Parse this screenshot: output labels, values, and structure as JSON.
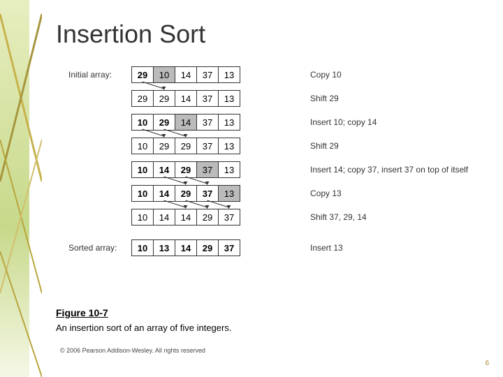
{
  "title": "Insertion Sort",
  "labels": {
    "initial": "Initial array:",
    "sorted": "Sorted array:"
  },
  "rows": [
    {
      "left": "Initial array:",
      "cells": [
        {
          "v": "29",
          "bold": true,
          "shade": false
        },
        {
          "v": "10",
          "bold": false,
          "shade": true
        },
        {
          "v": "14",
          "bold": false,
          "shade": false
        },
        {
          "v": "37",
          "bold": false,
          "shade": false
        },
        {
          "v": "13",
          "bold": false,
          "shade": false
        }
      ],
      "action": "Copy 10",
      "arrows": [
        {
          "from": 0,
          "to": 1
        }
      ]
    },
    {
      "left": "",
      "cells": [
        {
          "v": "29",
          "bold": false,
          "shade": false
        },
        {
          "v": "29",
          "bold": false,
          "shade": false
        },
        {
          "v": "14",
          "bold": false,
          "shade": false
        },
        {
          "v": "37",
          "bold": false,
          "shade": false
        },
        {
          "v": "13",
          "bold": false,
          "shade": false
        }
      ],
      "action": "Shift 29",
      "arrows": []
    },
    {
      "left": "",
      "cells": [
        {
          "v": "10",
          "bold": true,
          "shade": false
        },
        {
          "v": "29",
          "bold": true,
          "shade": false
        },
        {
          "v": "14",
          "bold": false,
          "shade": true
        },
        {
          "v": "37",
          "bold": false,
          "shade": false
        },
        {
          "v": "13",
          "bold": false,
          "shade": false
        }
      ],
      "action": "Insert 10; copy 14",
      "arrows": [
        {
          "from": 0,
          "to": 1
        },
        {
          "from": 1,
          "to": 2
        }
      ]
    },
    {
      "left": "",
      "cells": [
        {
          "v": "10",
          "bold": false,
          "shade": false
        },
        {
          "v": "29",
          "bold": false,
          "shade": false
        },
        {
          "v": "29",
          "bold": false,
          "shade": false
        },
        {
          "v": "37",
          "bold": false,
          "shade": false
        },
        {
          "v": "13",
          "bold": false,
          "shade": false
        }
      ],
      "action": "Shift 29",
      "arrows": []
    },
    {
      "left": "",
      "cells": [
        {
          "v": "10",
          "bold": true,
          "shade": false
        },
        {
          "v": "14",
          "bold": true,
          "shade": false
        },
        {
          "v": "29",
          "bold": true,
          "shade": false
        },
        {
          "v": "37",
          "bold": false,
          "shade": true
        },
        {
          "v": "13",
          "bold": false,
          "shade": false
        }
      ],
      "action": "Insert 14; copy 37, insert 37 on top of itself",
      "arrows": [
        {
          "from": 1,
          "to": 2
        },
        {
          "from": 2,
          "to": 3
        }
      ]
    },
    {
      "left": "",
      "cells": [
        {
          "v": "10",
          "bold": true,
          "shade": false
        },
        {
          "v": "14",
          "bold": true,
          "shade": false
        },
        {
          "v": "29",
          "bold": true,
          "shade": false
        },
        {
          "v": "37",
          "bold": true,
          "shade": false
        },
        {
          "v": "13",
          "bold": false,
          "shade": true
        }
      ],
      "action": "Copy 13",
      "arrows": [
        {
          "from": 1,
          "to": 2
        },
        {
          "from": 2,
          "to": 3
        },
        {
          "from": 3,
          "to": 4
        }
      ]
    },
    {
      "left": "",
      "cells": [
        {
          "v": "10",
          "bold": false,
          "shade": false
        },
        {
          "v": "14",
          "bold": false,
          "shade": false
        },
        {
          "v": "14",
          "bold": false,
          "shade": false
        },
        {
          "v": "29",
          "bold": false,
          "shade": false
        },
        {
          "v": "37",
          "bold": false,
          "shade": false
        }
      ],
      "action": "Shift 37, 29, 14",
      "arrows": []
    },
    {
      "left": "Sorted array:",
      "cells": [
        {
          "v": "10",
          "bold": true,
          "shade": false
        },
        {
          "v": "13",
          "bold": true,
          "shade": false
        },
        {
          "v": "14",
          "bold": true,
          "shade": false
        },
        {
          "v": "29",
          "bold": true,
          "shade": false
        },
        {
          "v": "37",
          "bold": true,
          "shade": false
        }
      ],
      "action": "Insert 13",
      "arrows": []
    }
  ],
  "figure_label": "Figure 10-7",
  "figure_caption": "An insertion sort of an array of five integers.",
  "copyright": "© 2006 Pearson Addison-Wesley. All rights reserved",
  "slide_no": "6"
}
